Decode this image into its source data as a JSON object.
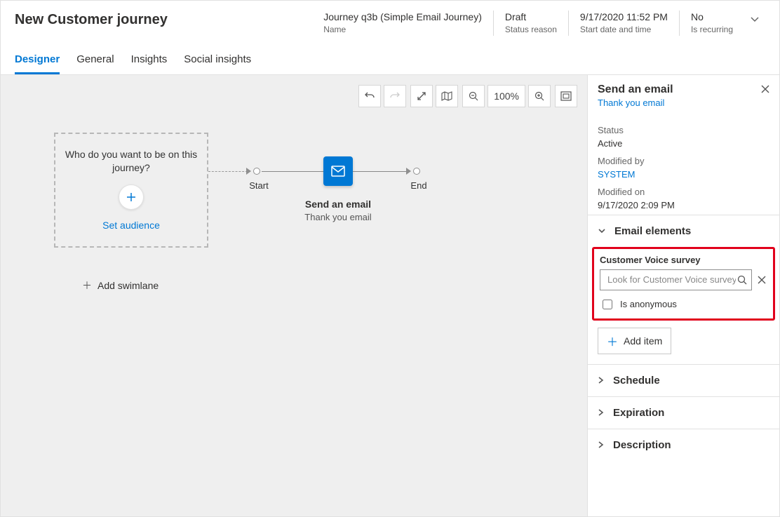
{
  "header": {
    "title": "New Customer journey",
    "name_value": "Journey q3b (Simple Email Journey)",
    "name_label": "Name",
    "status_value": "Draft",
    "status_label": "Status reason",
    "start_value": "9/17/2020 11:52 PM",
    "start_label": "Start date and time",
    "recurring_value": "No",
    "recurring_label": "Is recurring"
  },
  "tabs": {
    "designer": "Designer",
    "general": "General",
    "insights": "Insights",
    "social": "Social insights"
  },
  "toolbar": {
    "zoom": "100%"
  },
  "canvas": {
    "audience_question": "Who do you want to be on this journey?",
    "set_audience": "Set audience",
    "start": "Start",
    "end": "End",
    "tile_title": "Send an email",
    "tile_sub": "Thank you email",
    "add_swimlane": "Add swimlane"
  },
  "side": {
    "title": "Send an email",
    "link": "Thank you email",
    "status_label": "Status",
    "status_value": "Active",
    "modby_label": "Modified by",
    "modby_value": "SYSTEM",
    "modon_label": "Modified on",
    "modon_value": "9/17/2020 2:09 PM",
    "sections": {
      "elements": "Email elements",
      "schedule": "Schedule",
      "expiration": "Expiration",
      "description": "Description"
    },
    "survey": {
      "label": "Customer Voice survey",
      "placeholder": "Look for Customer Voice survey",
      "anon": "Is anonymous"
    },
    "add_item": "Add item"
  }
}
